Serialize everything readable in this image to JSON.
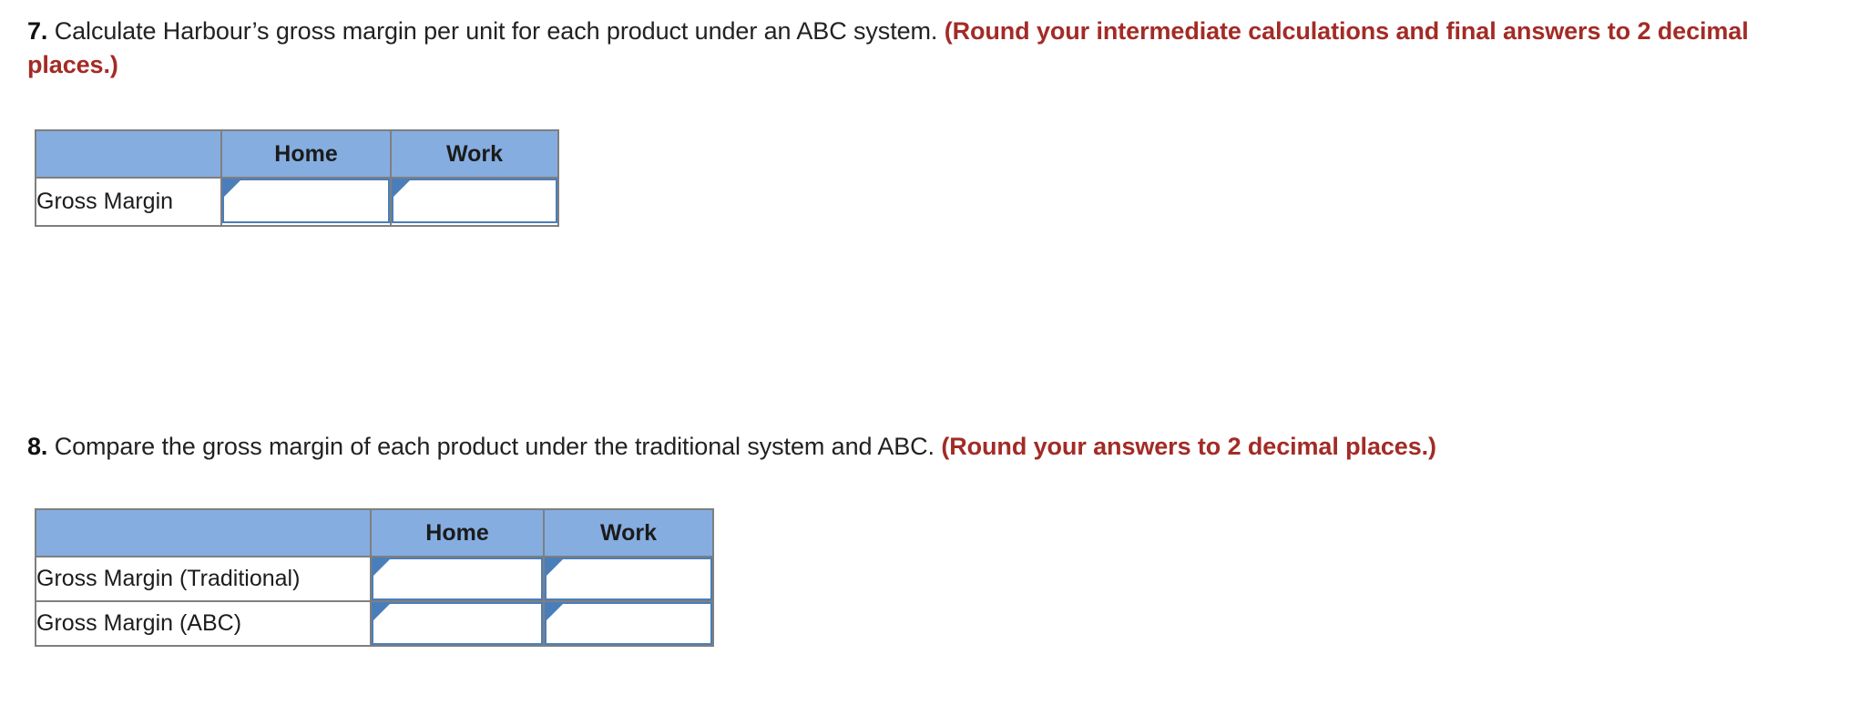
{
  "questions": [
    {
      "number": "7.",
      "text": " Calculate Harbour’s gross margin per unit for each product under an ABC system. ",
      "note": "(Round your intermediate calculations and final answers to 2 decimal places.)"
    },
    {
      "number": "8.",
      "text": " Compare the gross margin of each product under the traditional system and ABC. ",
      "note": "(Round your answers to 2 decimal places.)"
    }
  ],
  "tables": [
    {
      "id": "table-q7",
      "corner_header": "",
      "columns": [
        "Home",
        "Work"
      ],
      "rows": [
        {
          "label": "Gross Margin",
          "values": [
            "",
            ""
          ]
        }
      ]
    },
    {
      "id": "table-q8",
      "corner_header": "",
      "columns": [
        "Home",
        "Work"
      ],
      "rows": [
        {
          "label": "Gross Margin (Traditional)",
          "values": [
            "",
            ""
          ]
        },
        {
          "label": "Gross Margin (ABC)",
          "values": [
            "",
            ""
          ]
        }
      ]
    }
  ],
  "colors": {
    "header_blue": "#85ADE0",
    "input_border_blue": "#4A7EBB",
    "cell_border_gray": "#7F7F7F",
    "note_red": "#A32B26",
    "body_text": "#222222",
    "background": "#FFFFFF"
  },
  "icons": {
    "input_marker": "triangle-right-icon"
  }
}
